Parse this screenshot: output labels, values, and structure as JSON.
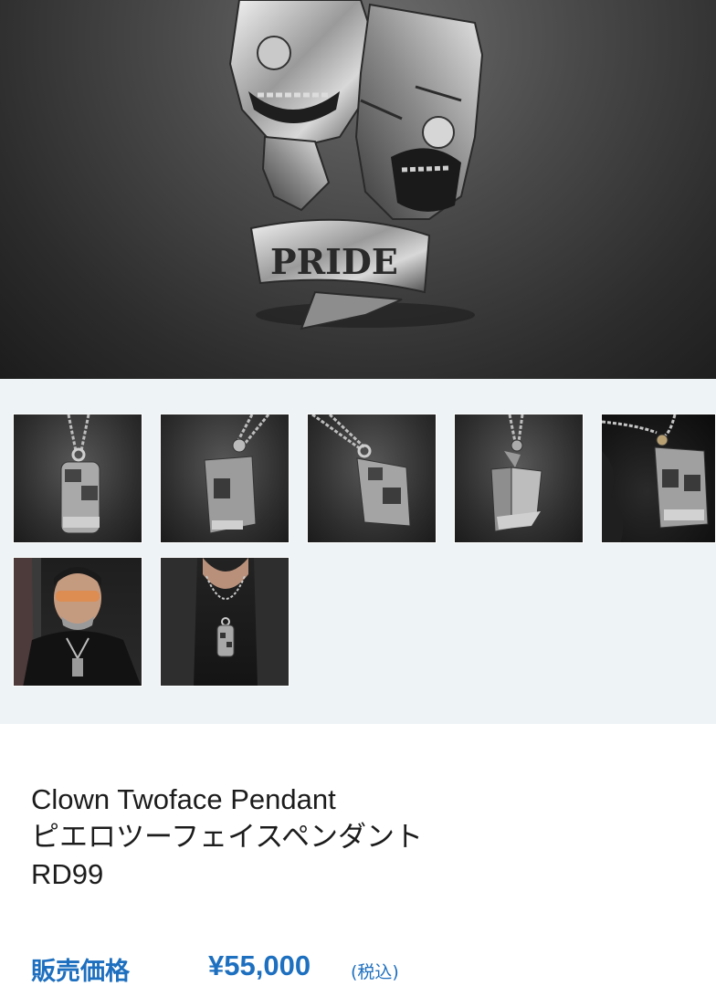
{
  "product": {
    "name_en": "Clown Twoface Pendant",
    "name_ja": "ピエロツーフェイスペンダント",
    "code": "RD99"
  },
  "price": {
    "label": "販売価格",
    "value": "¥55,000",
    "tax_note": "(税込)"
  },
  "hero": {
    "engraving": "PRIDE"
  },
  "gallery": {
    "thumbnails": [
      {
        "name": "front view"
      },
      {
        "name": "left angle"
      },
      {
        "name": "right angle"
      },
      {
        "name": "side view"
      },
      {
        "name": "on black fabric"
      },
      {
        "name": "worn model portrait"
      },
      {
        "name": "worn model close-up"
      }
    ]
  },
  "colors": {
    "accent": "#1d6fbf",
    "gallery_bg": "#eef3f5"
  }
}
